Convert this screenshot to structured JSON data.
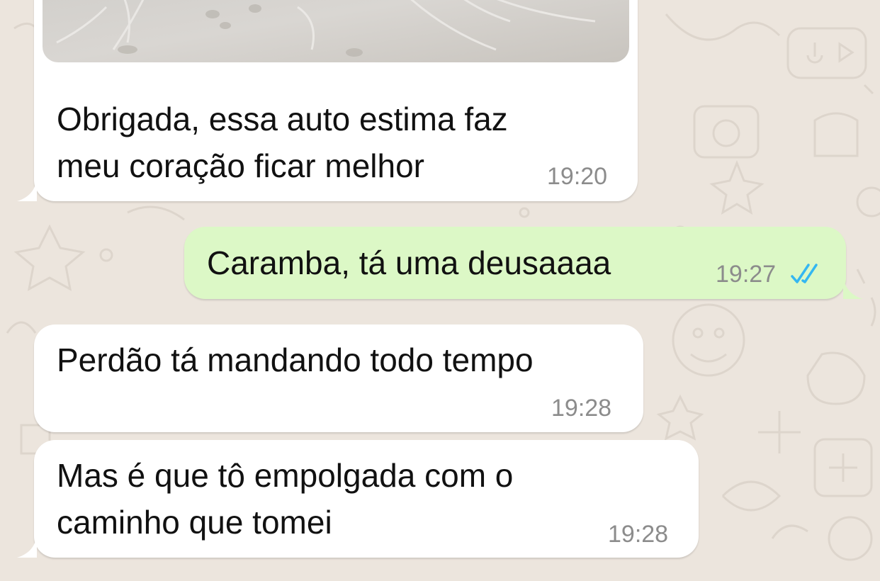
{
  "colors": {
    "chat_background": "#ECE5DD",
    "incoming_bubble": "#FFFFFF",
    "outgoing_bubble": "#DCF8C6",
    "timestamp": "#8C8C8C",
    "read_receipt": "#34B7F1"
  },
  "messages": [
    {
      "direction": "incoming",
      "has_photo": true,
      "photo_subject": "sand beach",
      "text": "Obrigada, essa auto estima faz\nmeu coração ficar melhor",
      "time": "19:20"
    },
    {
      "direction": "outgoing",
      "text": "Caramba, tá uma deusaaaa",
      "time": "19:27",
      "status_icon": "double-check-icon",
      "status": "read"
    },
    {
      "direction": "incoming",
      "text": "Perdão tá mandando todo tempo",
      "time": "19:28"
    },
    {
      "direction": "incoming",
      "text": "Mas é que tô empolgada com o\ncaminho que tomei",
      "time": "19:28"
    }
  ]
}
